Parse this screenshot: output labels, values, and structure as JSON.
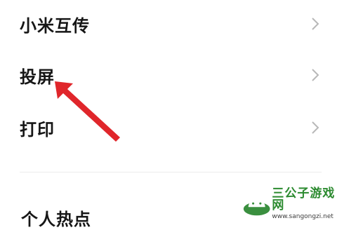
{
  "menu": {
    "items": [
      {
        "label": "小米互传"
      },
      {
        "label": "投屏"
      },
      {
        "label": "打印"
      }
    ]
  },
  "section": {
    "title": "个人热点"
  },
  "watermark": {
    "title": "三公子游戏网",
    "url": "www.sangongzi.net"
  },
  "colors": {
    "arrow": "#e0262b",
    "chevron": "#b8b8b8",
    "divider": "#ececec",
    "watermark_green": "#2b8a2f"
  },
  "icons": {
    "chevron": "chevron-right-icon",
    "arrow": "red-pointer-arrow",
    "watermark_logo": "android-logo-icon"
  }
}
